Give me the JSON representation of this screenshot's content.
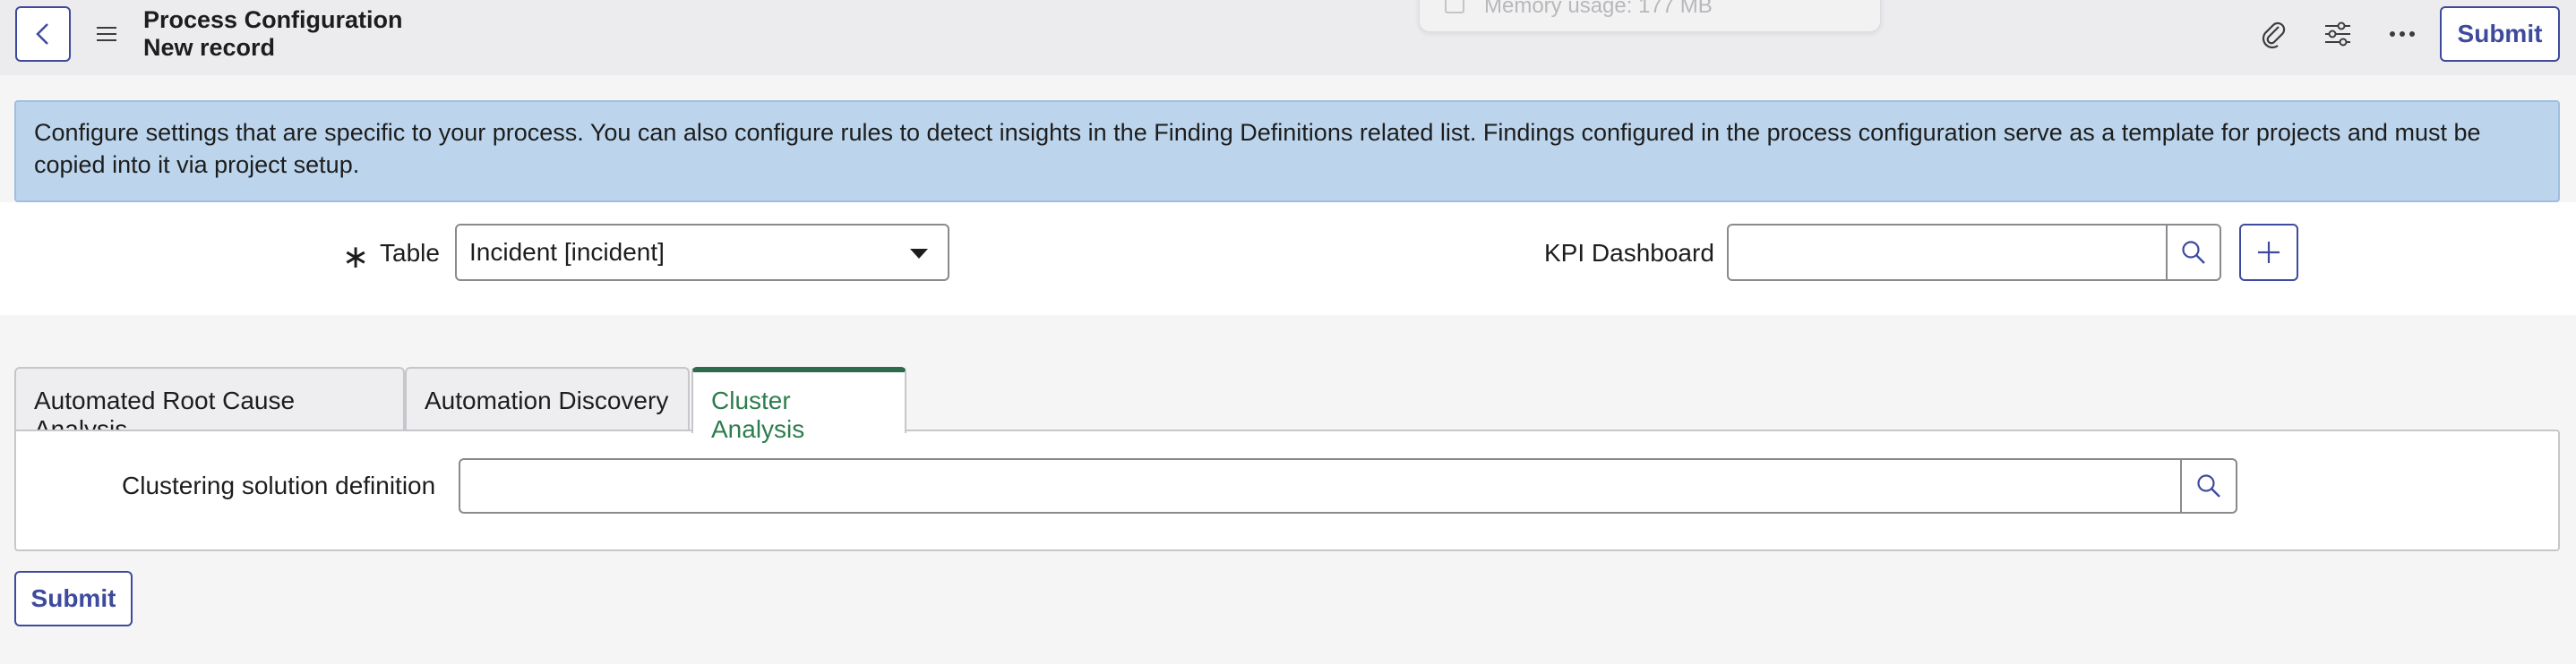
{
  "header": {
    "title": "Process Configuration",
    "subtitle": "New record",
    "memory_text": "Memory usage: 177 MB",
    "submit_label": "Submit",
    "icons": [
      "back-icon",
      "menu-icon",
      "paperclip-icon",
      "sliders-icon",
      "more-icon"
    ]
  },
  "banner": {
    "text": "Configure settings that are specific to your process. You can also configure rules to detect insights in the Finding Definitions related list. Findings configured in the process configuration serve as a template for projects and must be copied into it via project setup."
  },
  "form": {
    "table_required_mark": "∗",
    "table_label": "Table",
    "table_value": "Incident [incident]",
    "kpi_label": "KPI Dashboard",
    "kpi_value": ""
  },
  "tabs": [
    {
      "label": "Automated Root Cause Analysis",
      "active": false
    },
    {
      "label": "Automation Discovery",
      "active": false
    },
    {
      "label": "Cluster Analysis",
      "active": true
    }
  ],
  "cluster": {
    "label": "Clustering solution definition",
    "value": ""
  },
  "footer": {
    "submit_label": "Submit"
  },
  "colors": {
    "accent": "#3e4a9c",
    "active_tab": "#2d7d4e",
    "banner_bg": "#bcd5ec"
  }
}
